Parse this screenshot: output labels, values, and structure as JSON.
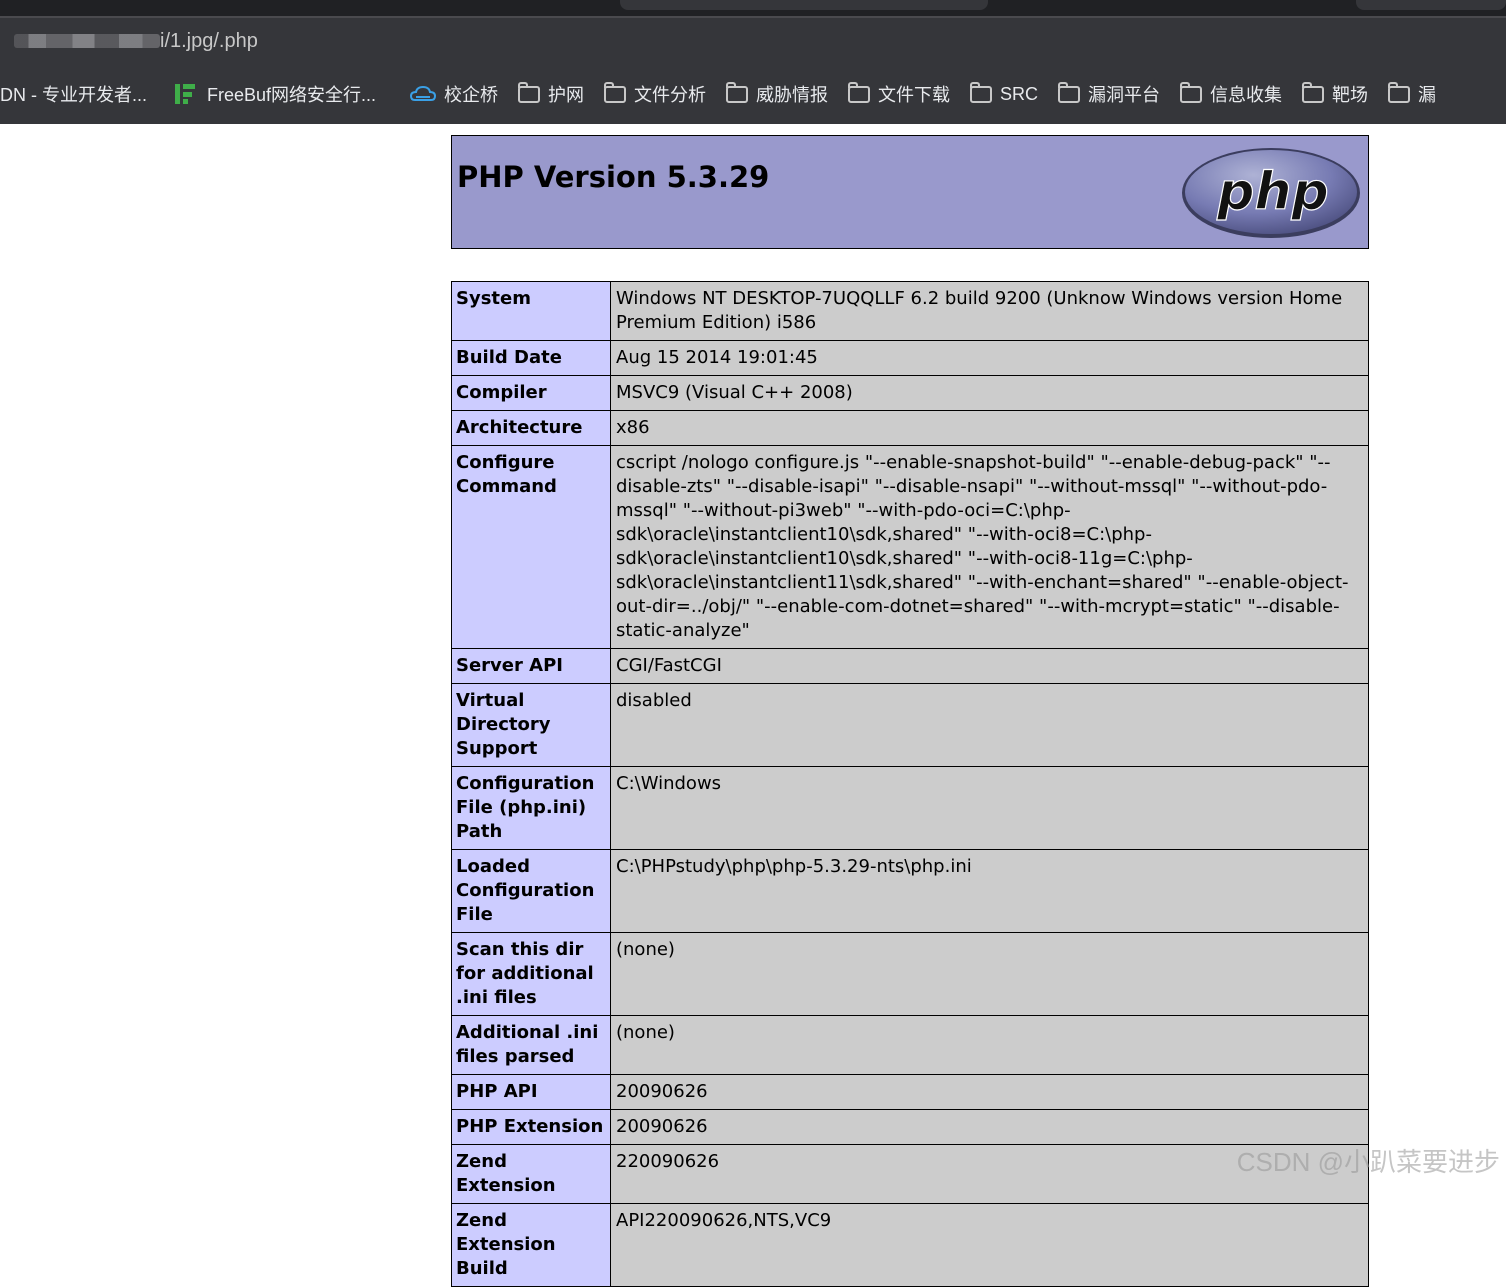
{
  "browser": {
    "url_visible": "i/1.jpg/.php",
    "bookmarks": [
      {
        "label": "DN - 专业开发者...",
        "icon": "none"
      },
      {
        "label": "FreeBuf网络安全行...",
        "icon": "freebuf-icon"
      },
      {
        "label": "校企桥",
        "icon": "cloud-icon"
      },
      {
        "label": "护网",
        "icon": "folder-icon"
      },
      {
        "label": "文件分析",
        "icon": "folder-icon"
      },
      {
        "label": "威胁情报",
        "icon": "folder-icon"
      },
      {
        "label": "文件下载",
        "icon": "folder-icon"
      },
      {
        "label": "SRC",
        "icon": "folder-icon"
      },
      {
        "label": "漏洞平台",
        "icon": "folder-icon"
      },
      {
        "label": "信息收集",
        "icon": "folder-icon"
      },
      {
        "label": "靶场",
        "icon": "folder-icon"
      },
      {
        "label": "漏",
        "icon": "folder-icon"
      }
    ]
  },
  "phpinfo": {
    "title": "PHP Version 5.3.29",
    "logo_text": "php",
    "rows": [
      {
        "key": "System",
        "value": "Windows NT DESKTOP-7UQQLLF 6.2 build 9200 (Unknow Windows version Home Premium Edition) i586"
      },
      {
        "key": "Build Date",
        "value": "Aug 15 2014 19:01:45"
      },
      {
        "key": "Compiler",
        "value": "MSVC9 (Visual C++ 2008)"
      },
      {
        "key": "Architecture",
        "value": "x86"
      },
      {
        "key": "Configure Command",
        "value": "cscript /nologo configure.js \"--enable-snapshot-build\" \"--enable-debug-pack\" \"--disable-zts\" \"--disable-isapi\" \"--disable-nsapi\" \"--without-mssql\" \"--without-pdo-mssql\" \"--without-pi3web\" \"--with-pdo-oci=C:\\php-sdk\\oracle\\instantclient10\\sdk,shared\" \"--with-oci8=C:\\php-sdk\\oracle\\instantclient10\\sdk,shared\" \"--with-oci8-11g=C:\\php-sdk\\oracle\\instantclient11\\sdk,shared\" \"--with-enchant=shared\" \"--enable-object-out-dir=../obj/\" \"--enable-com-dotnet=shared\" \"--with-mcrypt=static\" \"--disable-static-analyze\""
      },
      {
        "key": "Server API",
        "value": "CGI/FastCGI"
      },
      {
        "key": "Virtual Directory Support",
        "value": "disabled"
      },
      {
        "key": "Configuration File (php.ini) Path",
        "value": "C:\\Windows"
      },
      {
        "key": "Loaded Configuration File",
        "value": "C:\\PHPstudy\\php\\php-5.3.29-nts\\php.ini"
      },
      {
        "key": "Scan this dir for additional .ini files",
        "value": "(none)"
      },
      {
        "key": "Additional .ini files parsed",
        "value": "(none)"
      },
      {
        "key": "PHP API",
        "value": "20090626"
      },
      {
        "key": "PHP Extension",
        "value": "20090626"
      },
      {
        "key": "Zend Extension",
        "value": "220090626"
      },
      {
        "key": "Zend Extension Build",
        "value": "API220090626,NTS,VC9"
      }
    ]
  },
  "watermark": "CSDN @小趴菜要进步"
}
